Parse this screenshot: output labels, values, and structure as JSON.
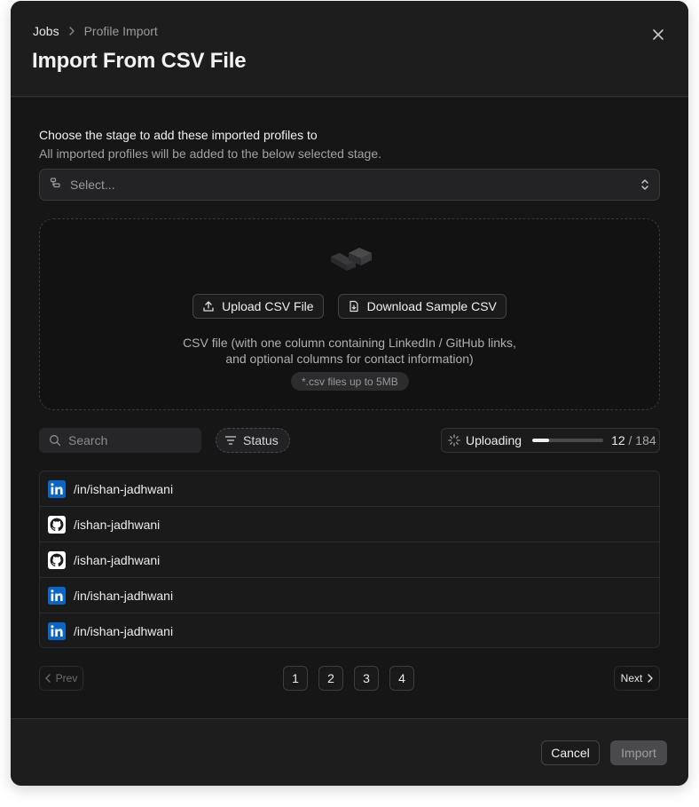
{
  "breadcrumb": {
    "root": "Jobs",
    "current": "Profile Import"
  },
  "title": "Import From CSV File",
  "stage": {
    "label": "Choose the stage to add these imported profiles to",
    "help": "All imported profiles will be added to the below selected stage.",
    "placeholder": "Select..."
  },
  "dropzone": {
    "upload_label": "Upload CSV File",
    "sample_label": "Download Sample CSV",
    "description_line1": "CSV file (with one column containing LinkedIn / GitHub links,",
    "description_line2": "and optional columns for contact information)",
    "hint": "*.csv files up to 5MB"
  },
  "toolbar": {
    "search_placeholder": "Search",
    "status_label": "Status",
    "uploading_label": "Uploading",
    "progress_fraction": 0.065,
    "count_done": "12",
    "count_total": "/ 184"
  },
  "profiles": [
    {
      "source": "linkedin",
      "label": "/in/ishan-jadhwani"
    },
    {
      "source": "github",
      "label": "/ishan-jadhwani"
    },
    {
      "source": "github",
      "label": "/ishan-jadhwani"
    },
    {
      "source": "linkedin",
      "label": "/in/ishan-jadhwani"
    },
    {
      "source": "linkedin",
      "label": "/in/ishan-jadhwani"
    }
  ],
  "pagination": {
    "prev": "Prev",
    "next": "Next",
    "pages": [
      "1",
      "2",
      "3",
      "4"
    ]
  },
  "footer": {
    "cancel": "Cancel",
    "import": "Import"
  },
  "colors": {
    "linkedin": "#0a66c2",
    "github_bg": "#ffffff"
  }
}
